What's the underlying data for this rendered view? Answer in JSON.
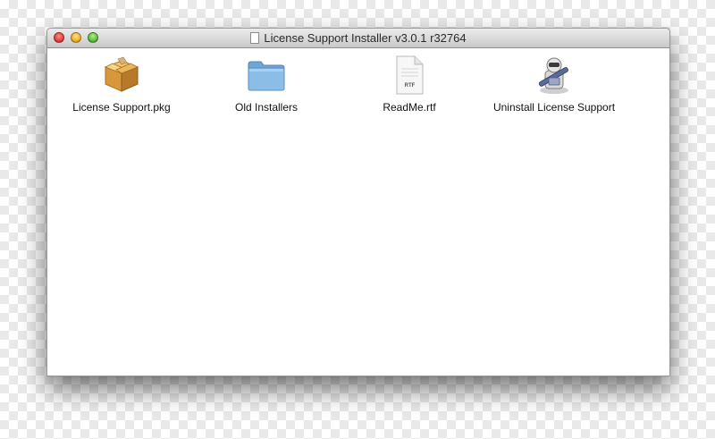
{
  "window": {
    "title": "License Support Installer v3.0.1 r32764"
  },
  "items": [
    {
      "label": "License Support.pkg",
      "icon": "package-icon"
    },
    {
      "label": "Old Installers",
      "icon": "folder-icon"
    },
    {
      "label": "ReadMe.rtf",
      "icon": "rtf-document-icon",
      "badge": "RTF"
    },
    {
      "label": "Uninstall License Support",
      "icon": "automator-icon"
    }
  ],
  "colors": {
    "folder": "#7fb2df",
    "package": "#d9a24a",
    "window_bg": "#ffffff"
  }
}
